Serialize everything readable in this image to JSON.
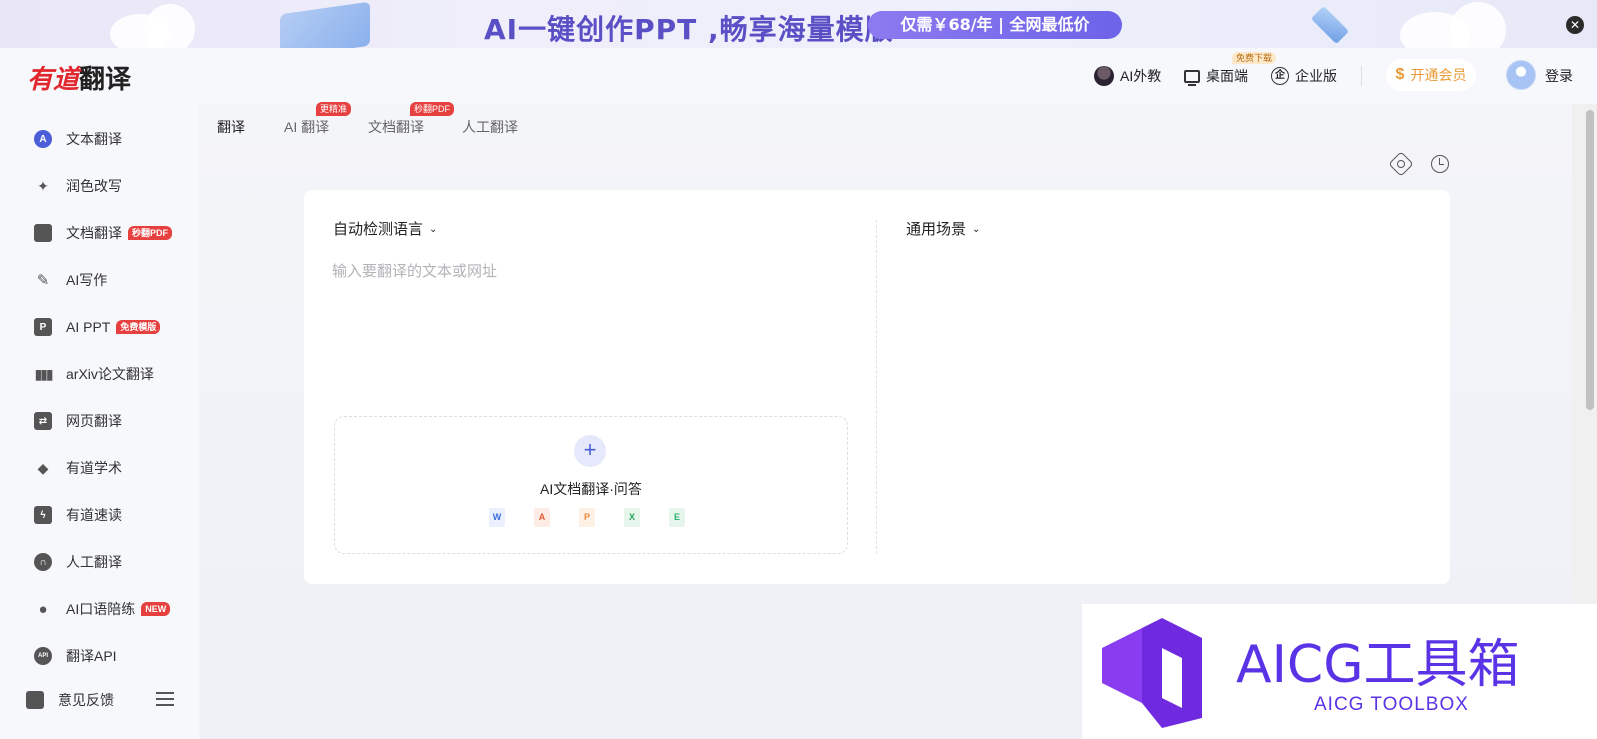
{
  "banner": {
    "title": "AI一键创作PPT ,畅享海量模版",
    "promo": "仅需￥68/年 | 全网最低价",
    "close": "✕"
  },
  "header": {
    "logo_red": "有道",
    "logo_dark": "翻译",
    "ai_tutor": "AI外教",
    "desktop": "桌面端",
    "desktop_badge": "免费下载",
    "enterprise": "企业版",
    "enterprise_icon_text": "企",
    "vip": "开通会员",
    "vip_icon": "$",
    "login": "登录"
  },
  "sidebar": {
    "items": [
      {
        "label": "文本翻译",
        "icon": "A",
        "tag": ""
      },
      {
        "label": "润色改写",
        "icon": "",
        "tag": ""
      },
      {
        "label": "文档翻译",
        "icon": "",
        "tag": "秒翻PDF"
      },
      {
        "label": "AI写作",
        "icon": "",
        "tag": ""
      },
      {
        "label": "AI PPT",
        "icon": "",
        "tag": "免费模版"
      },
      {
        "label": "arXiv论文翻译",
        "icon": "",
        "tag": ""
      },
      {
        "label": "网页翻译",
        "icon": "",
        "tag": ""
      },
      {
        "label": "有道学术",
        "icon": "",
        "tag": ""
      },
      {
        "label": "有道速读",
        "icon": "",
        "tag": ""
      },
      {
        "label": "人工翻译",
        "icon": "",
        "tag": ""
      },
      {
        "label": "AI口语陪练",
        "icon": "",
        "tag": "NEW"
      },
      {
        "label": "翻译API",
        "icon": "API",
        "tag": ""
      },
      {
        "label": "意见反馈",
        "icon": "",
        "tag": ""
      }
    ]
  },
  "tabs": [
    {
      "label": "翻译",
      "badge": ""
    },
    {
      "label": "AI 翻译",
      "badge": "更精准"
    },
    {
      "label": "文档翻译",
      "badge": "秒翻PDF"
    },
    {
      "label": "人工翻译",
      "badge": ""
    }
  ],
  "translator": {
    "source_lang": "自动检测语言",
    "scene": "通用场景",
    "chevron": "⌄",
    "placeholder": "输入要翻译的文本或网址",
    "upload_label": "AI文档翻译·问答",
    "plus": "+",
    "file_types": [
      "W",
      "A",
      "P",
      "X",
      "E"
    ]
  },
  "watermark": {
    "title": "AICG工具箱",
    "subtitle": "AICG TOOLBOX"
  },
  "colors": {
    "brand_red": "#e1262d",
    "accent_blue": "#4b5ed8",
    "banner_purple": "#5b4fc6",
    "watermark_purple": "#5a33e6",
    "vip_orange": "#e89a37"
  }
}
